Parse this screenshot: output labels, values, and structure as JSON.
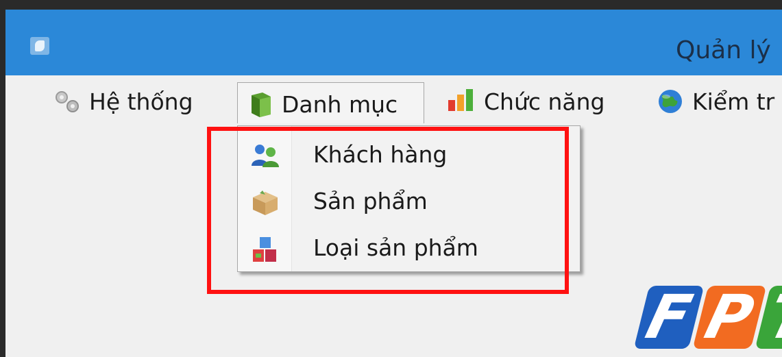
{
  "window": {
    "title": "Quản lý"
  },
  "menubar": {
    "items": [
      {
        "label": "Hệ thống",
        "icon": "gear-icon"
      },
      {
        "label": "Danh mục",
        "icon": "book-icon"
      },
      {
        "label": "Chức năng",
        "icon": "bar-chart-icon"
      },
      {
        "label": "Kiểm tr",
        "icon": "globe-icon"
      }
    ]
  },
  "dropdown": {
    "items": [
      {
        "label": "Khách hàng",
        "icon": "users-icon"
      },
      {
        "label": "Sản phẩm",
        "icon": "box-icon"
      },
      {
        "label": "Loại sản phẩm",
        "icon": "cubes-icon"
      }
    ]
  },
  "logo": {
    "letters": [
      "F",
      "P",
      "T"
    ],
    "dot": ".",
    "colors": [
      "#1f5fbf",
      "#f26b21",
      "#3aa53a"
    ]
  },
  "colors": {
    "titlebar": "#2b88d8",
    "highlight": "#ff1111"
  }
}
